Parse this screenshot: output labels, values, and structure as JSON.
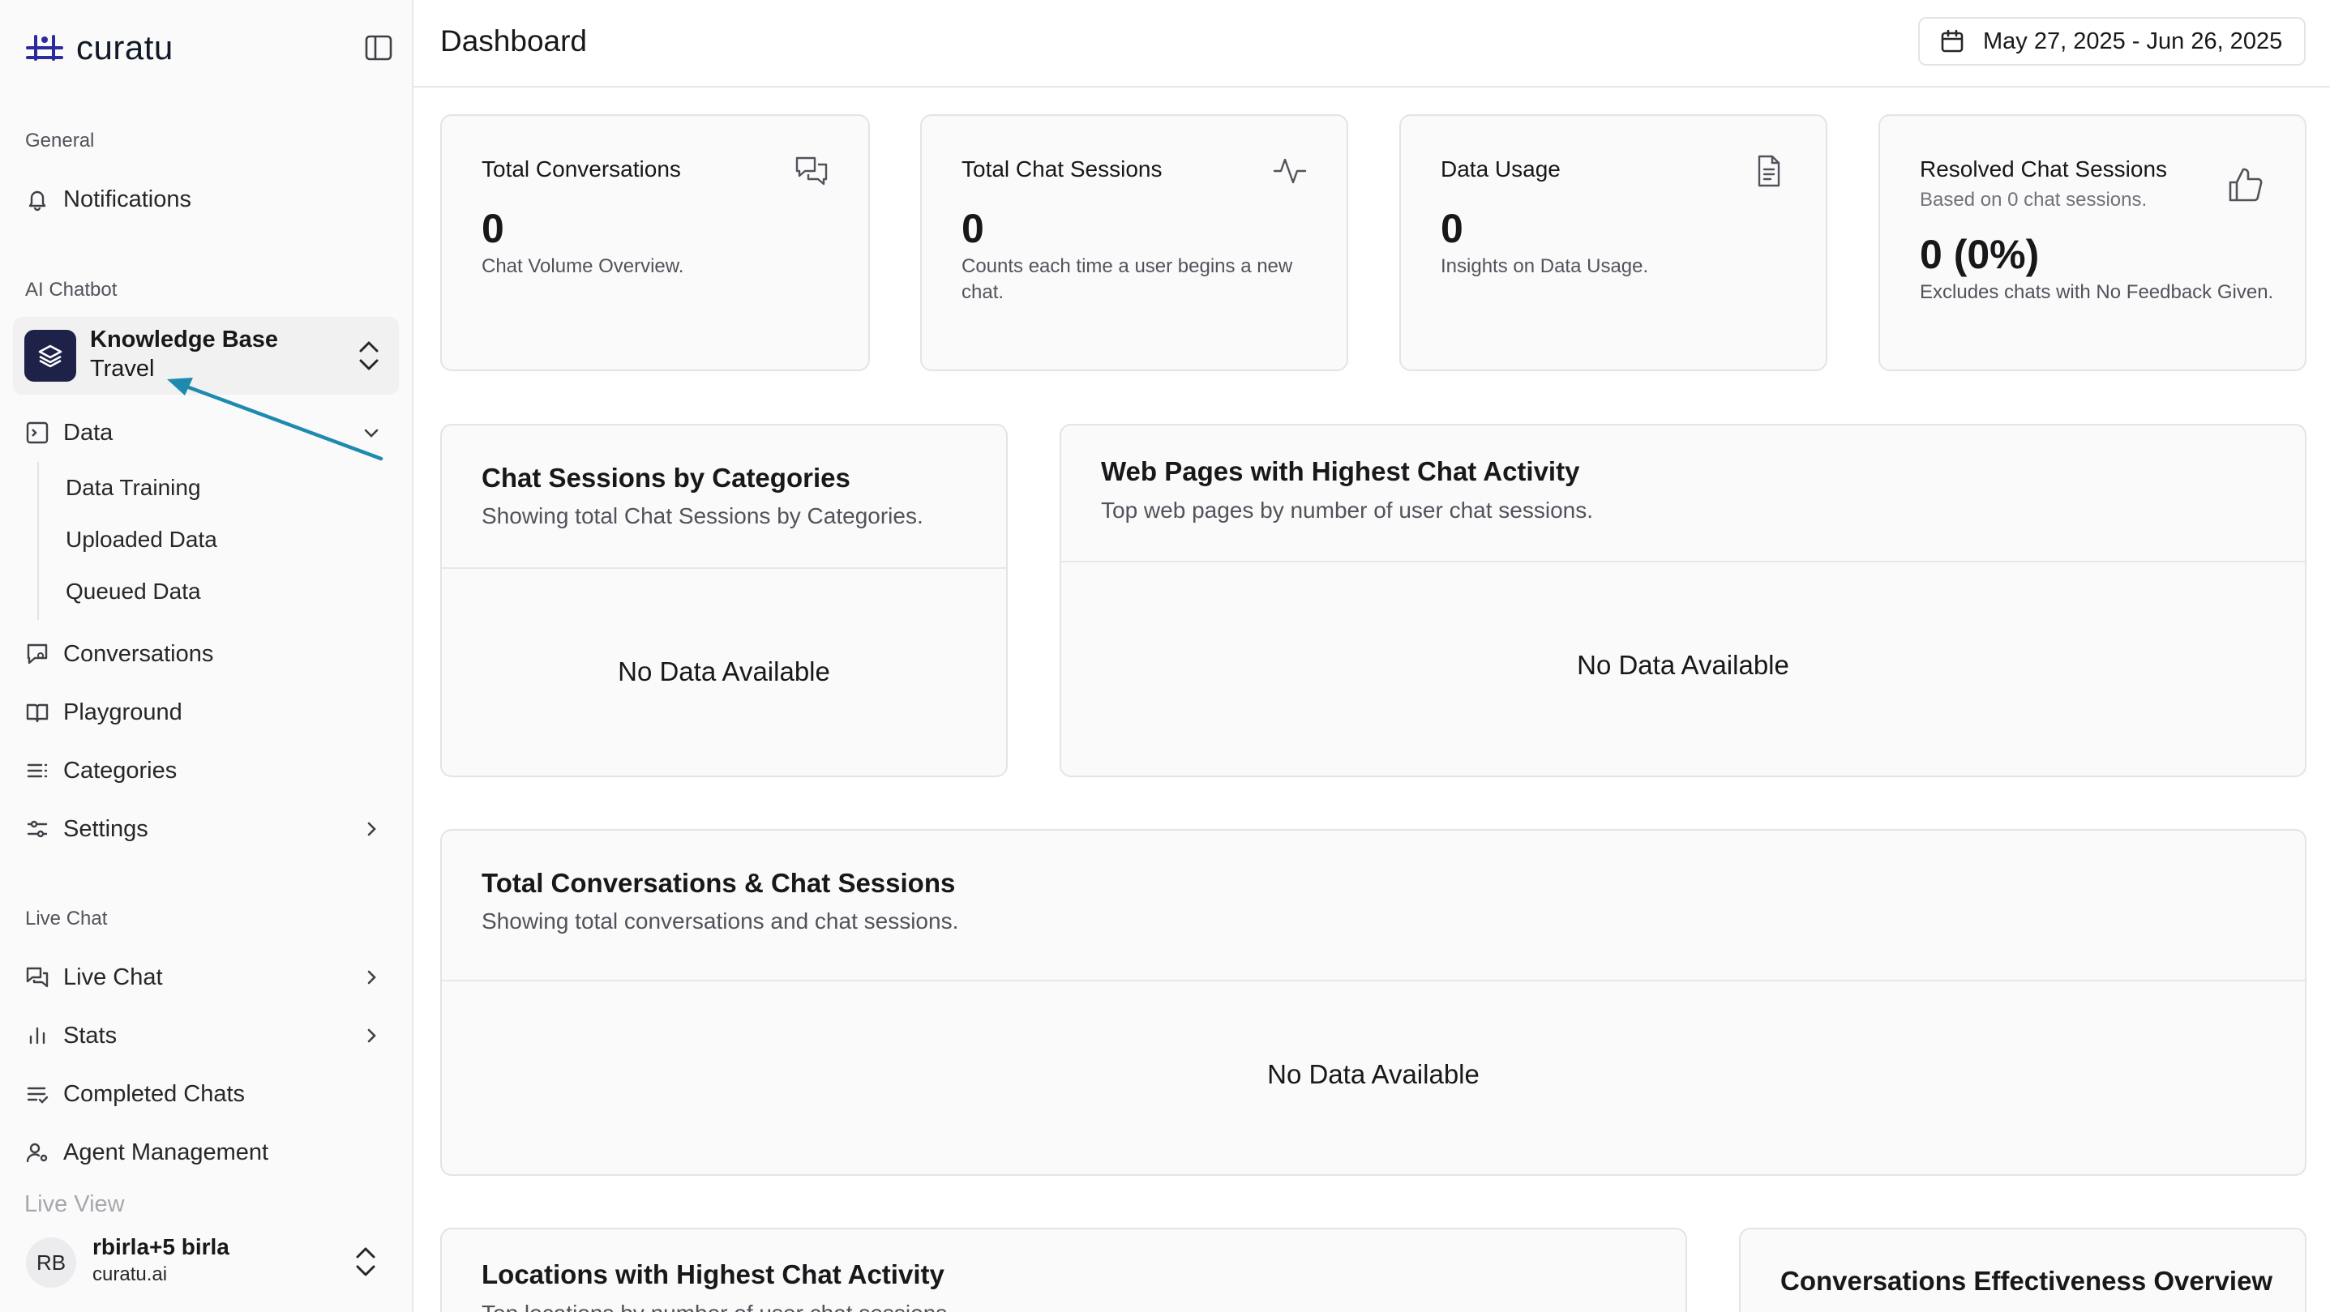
{
  "brand": {
    "name": "curatu",
    "accent": "#2d2a9e"
  },
  "sidebar": {
    "groups": {
      "general": "General",
      "ai_chatbot": "AI Chatbot",
      "live_chat": "Live Chat"
    },
    "notifications": "Notifications",
    "knowledge_base": {
      "title": "Knowledge Base",
      "subtitle": "Travel"
    },
    "data": {
      "label": "Data",
      "children": [
        "Data Training",
        "Uploaded Data",
        "Queued Data"
      ]
    },
    "ai_items": [
      "Conversations",
      "Playground",
      "Categories",
      "Settings"
    ],
    "live_items": [
      "Live Chat",
      "Stats",
      "Completed Chats",
      "Agent Management",
      "Live View"
    ],
    "user": {
      "initials": "RB",
      "name": "rbirla+5 birla",
      "email": "curatu.ai"
    }
  },
  "header": {
    "title": "Dashboard",
    "date_range": "May 27, 2025 - Jun 26, 2025"
  },
  "stats": [
    {
      "title": "Total Conversations",
      "value": "0",
      "desc": "Chat Volume Overview.",
      "icon": "chat-bubbles-icon"
    },
    {
      "title": "Total Chat Sessions",
      "value": "0",
      "desc": "Counts each time a user begins a new chat.",
      "icon": "activity-icon"
    },
    {
      "title": "Data Usage",
      "value": "0",
      "desc": "Insights on Data Usage.",
      "icon": "document-icon"
    },
    {
      "title": "Resolved Chat Sessions",
      "based": "Based on 0 chat sessions.",
      "value": "0 (0%)",
      "desc": "Excludes chats with No Feedback Given.",
      "icon": "thumbs-up-icon"
    }
  ],
  "panels": {
    "categories": {
      "title": "Chat Sessions by Categories",
      "subtitle": "Showing total Chat Sessions by Categories.",
      "empty": "No Data Available"
    },
    "web_pages": {
      "title": "Web Pages with Highest Chat Activity",
      "subtitle": "Top web pages by number of user chat sessions.",
      "empty": "No Data Available"
    },
    "totals": {
      "title": "Total Conversations & Chat Sessions",
      "subtitle": "Showing total conversations and chat sessions.",
      "empty": "No Data Available"
    },
    "locations": {
      "title": "Locations with Highest Chat Activity",
      "subtitle": "Top locations by number of user chat sessions."
    },
    "effectiveness": {
      "title": "Conversations Effectiveness Overview"
    }
  },
  "annotation": {
    "arrow_color": "#1f8ab0"
  }
}
